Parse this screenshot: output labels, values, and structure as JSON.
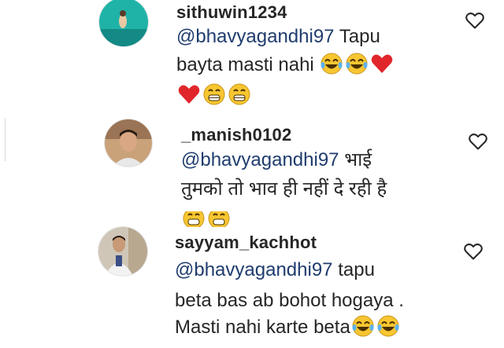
{
  "comments": [
    {
      "username": "sithuwin1234",
      "mention": "@bhavyagandhi97",
      "line1_rest": " Tapu",
      "line2": "bayta masti nahi ",
      "emojis_line2": [
        "laughing-tears",
        "laughing-tears",
        "red-heart"
      ],
      "emojis_line3": [
        "red-heart",
        "grinning",
        "grinning"
      ]
    },
    {
      "username": "_manish0102",
      "mention": "@bhavyagandhi97",
      "line1_rest": " भाई",
      "line2": "तुमको तो भाव ही नहीं दे रही है",
      "emojis_line3": [
        "grinning",
        "grinning"
      ]
    },
    {
      "username": "sayyam_kachhot",
      "mention": "@bhavyagandhi97",
      "line1_rest": " tapu",
      "line2": "beta bas ab bohot hogaya .",
      "line3": "Masti nahi karte beta",
      "emojis_line3": [
        "laughing-tears",
        "laughing-tears"
      ]
    }
  ],
  "icons": {
    "like": "heart-outline-icon"
  },
  "colors": {
    "text": "#262626",
    "mention": "#1f3c6e",
    "heart_red": "#e0262b",
    "emoji_yellow": "#f7c631"
  }
}
